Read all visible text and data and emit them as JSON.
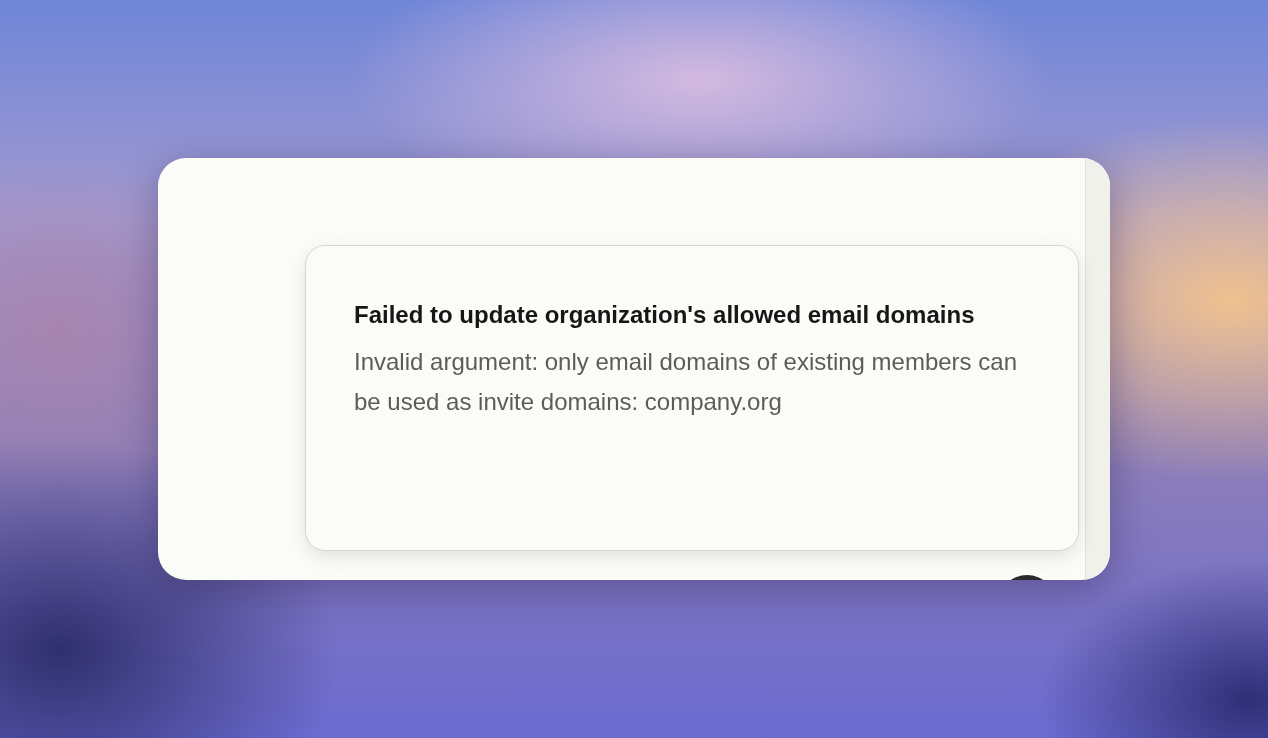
{
  "toast": {
    "title": "Failed to update organization's allowed email domains",
    "message": "Invalid argument: only email domains of existing members can be used as invite domains: company.org"
  }
}
